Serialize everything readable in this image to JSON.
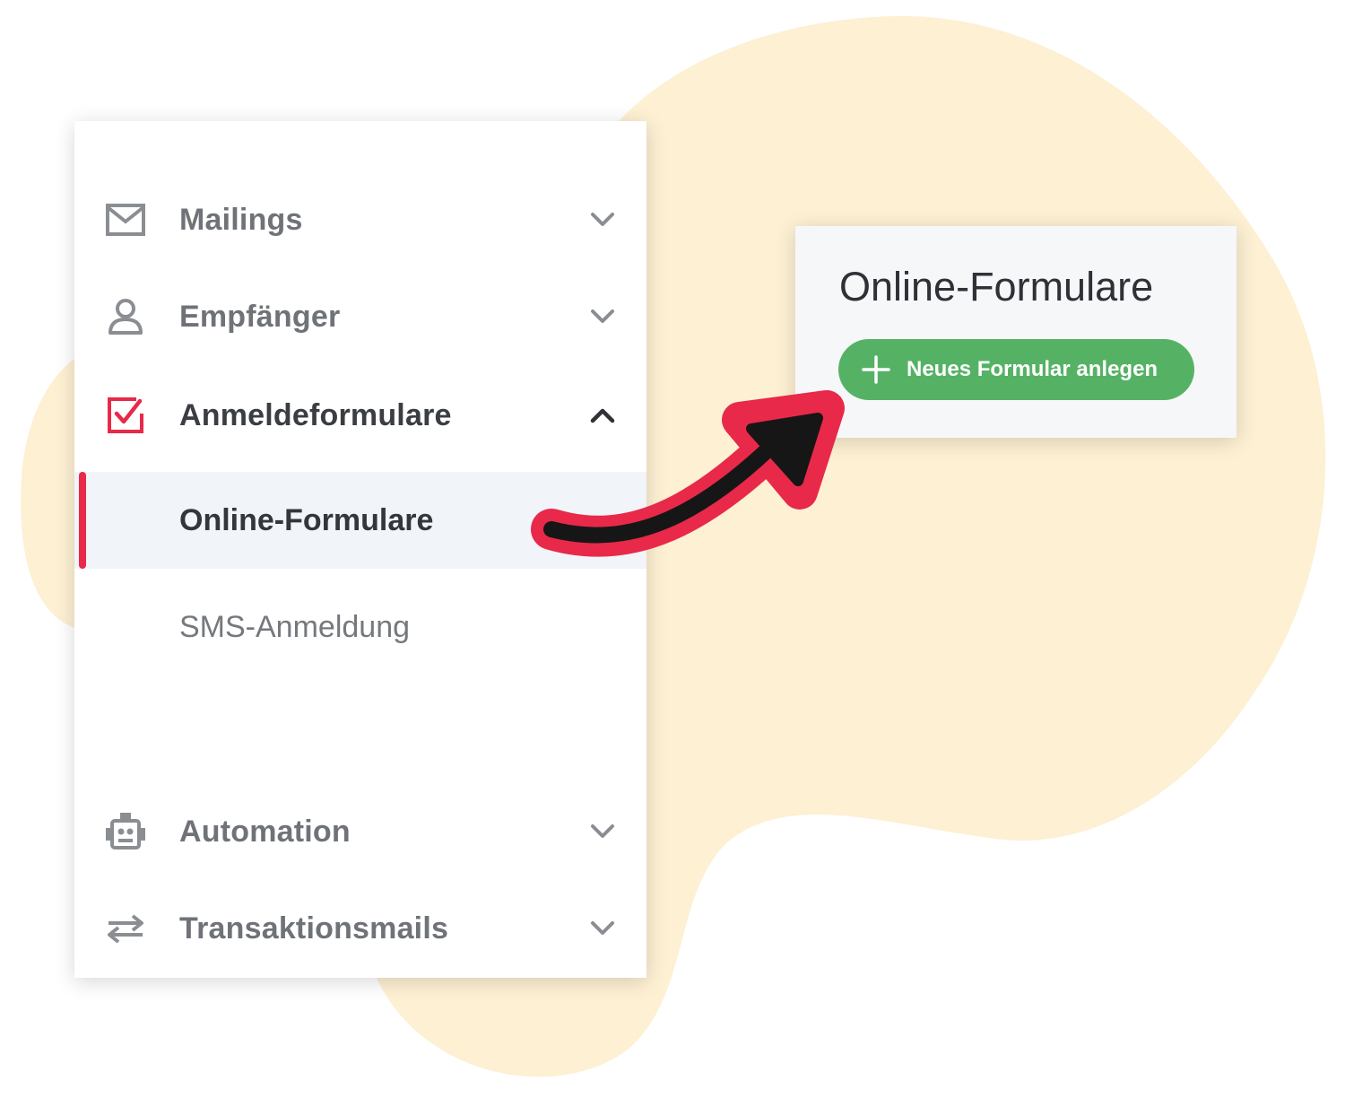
{
  "colors": {
    "accent": "#e8294a",
    "button_green": "#55b265",
    "background_blob": "#fdf0d3",
    "active_row_bg": "#f1f4f8"
  },
  "sidebar": {
    "items": [
      {
        "label": "Mailings",
        "icon": "mail-icon",
        "state": "collapsed"
      },
      {
        "label": "Empfänger",
        "icon": "user-icon",
        "state": "collapsed"
      },
      {
        "label": "Anmeldeformulare",
        "icon": "checkbox-icon",
        "state": "expanded",
        "children": [
          {
            "label": "Online-Formulare",
            "active": true
          },
          {
            "label": "SMS-Anmeldung",
            "active": false
          }
        ]
      },
      {
        "label": "Automation",
        "icon": "robot-icon",
        "state": "collapsed"
      },
      {
        "label": "Transaktionsmails",
        "icon": "swap-arrows-icon",
        "state": "collapsed"
      }
    ]
  },
  "card": {
    "title": "Online-Formulare",
    "button_label": "Neues Formular anlegen",
    "button_icon": "plus-icon"
  },
  "annotation": {
    "arrow_icon": "curved-arrow-icon"
  }
}
